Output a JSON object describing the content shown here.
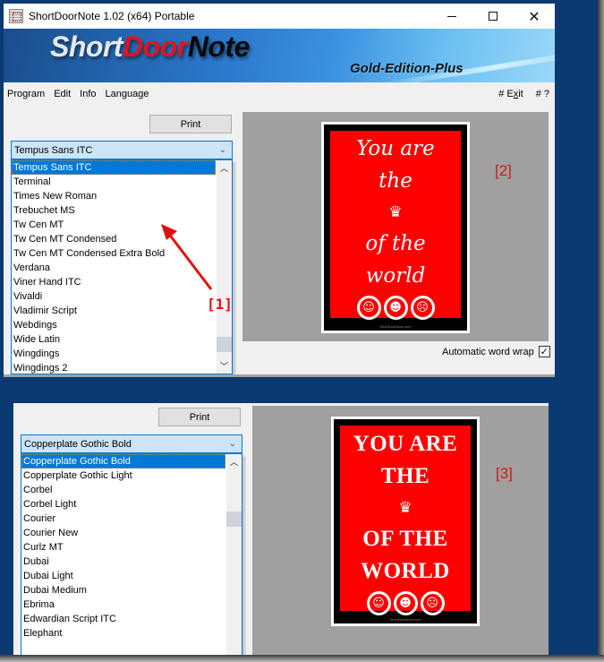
{
  "window": {
    "title": "ShortDoorNote 1.02  (x64) Portable",
    "minimize_label": "minimize",
    "maximize_label": "maximize",
    "close_label": "close"
  },
  "banner": {
    "logo_part1": "Short",
    "logo_part2": "Door",
    "logo_part3": "Note",
    "edition": "Gold-Edition-Plus",
    "colors": {
      "short": "#e6e8ec",
      "door": "#e0141c",
      "note": "#0a0a0a"
    }
  },
  "menu": {
    "left": [
      "Program",
      "Edit",
      "Info",
      "Language"
    ],
    "exit_prefix": "# E",
    "exit_underlined": "x",
    "exit_suffix": "it",
    "help": "# ?"
  },
  "panel1": {
    "print_label": "Print",
    "font_selected": "Tempus Sans ITC",
    "font_list": [
      "Tempus Sans ITC",
      "Terminal",
      "Times New Roman",
      "Trebuchet MS",
      "Tw Cen MT",
      "Tw Cen MT Condensed",
      "Tw Cen MT Condensed Extra Bold",
      "Verdana",
      "Viner Hand ITC",
      "Vivaldi",
      "Vladimir Script",
      "Webdings",
      "Wide Latin",
      "Wingdings",
      "Wingdings 2"
    ],
    "annotation_list": "[1]",
    "annotation_preview": "[2]",
    "word_wrap_label": "Automatic word wrap",
    "word_wrap_checked": true,
    "poster": {
      "line1": "You are",
      "line2": "the",
      "crown": "♛",
      "line3": "of the",
      "line4": "world",
      "emojis": [
        "😂",
        "🤣",
        "😒"
      ],
      "footer": "ShortDoorNote.com"
    }
  },
  "panel2": {
    "print_label": "Print",
    "font_selected": "Copperplate Gothic Bold",
    "font_list": [
      "Copperplate Gothic Bold",
      "Copperplate Gothic Light",
      "Corbel",
      "Corbel Light",
      "Courier",
      "Courier New",
      "Curlz MT",
      "Dubai",
      "Dubai Light",
      "Dubai Medium",
      "Ebrima",
      "Edwardian Script ITC",
      "Elephant"
    ],
    "annotation_preview": "[3]",
    "poster": {
      "line1": "YOU ARE",
      "line2": "THE",
      "crown": "♛",
      "line3": "OF THE",
      "line4": "WORLD",
      "emojis": [
        "😂",
        "🤣",
        "😒"
      ],
      "footer": "ShortDoorNote.com"
    }
  },
  "colors": {
    "desktop": "#0b3a72",
    "selection": "#0078d7",
    "poster_red": "#ff0000",
    "annotation_red": "#e01010"
  }
}
